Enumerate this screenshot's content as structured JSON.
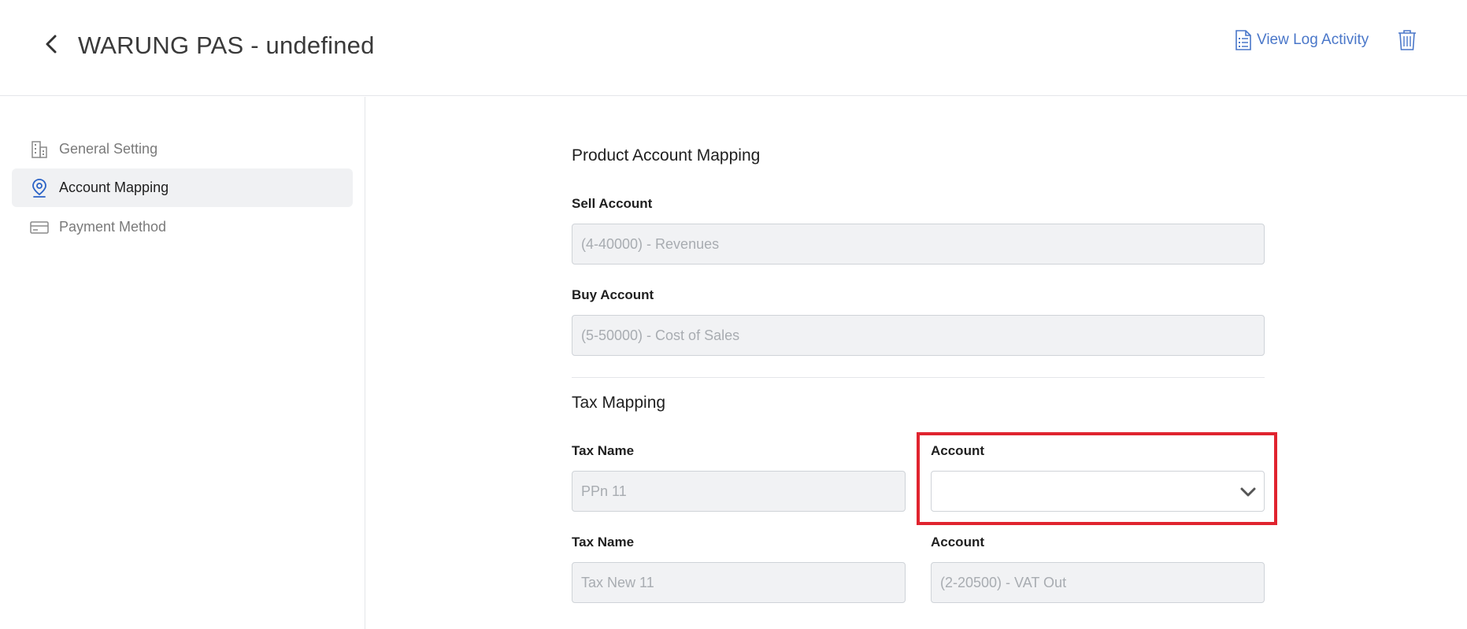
{
  "header": {
    "title": "WARUNG PAS - undefined",
    "log_label": "View Log Activity",
    "icons": {
      "back": "chevron-left-icon",
      "log": "document-list-icon",
      "delete": "trash-icon"
    }
  },
  "sidebar": {
    "items": [
      {
        "label": "General Setting",
        "icon": "building-icon",
        "active": false
      },
      {
        "label": "Account Mapping",
        "icon": "map-pin-icon",
        "active": true
      },
      {
        "label": "Payment Method",
        "icon": "credit-card-icon",
        "active": false
      }
    ]
  },
  "product_mapping": {
    "title": "Product Account Mapping",
    "sell": {
      "label": "Sell Account",
      "value": "(4-40000) - Revenues"
    },
    "buy": {
      "label": "Buy Account",
      "value": "(5-50000) - Cost of Sales"
    }
  },
  "tax_mapping": {
    "title": "Tax Mapping",
    "rows": [
      {
        "tax_label": "Tax Name",
        "tax_value": "PPn 11",
        "account_label": "Account",
        "account_value": ""
      },
      {
        "tax_label": "Tax Name",
        "tax_value": "Tax New 11",
        "account_label": "Account",
        "account_value": "(2-20500) - VAT Out"
      }
    ]
  },
  "colors": {
    "accent": "#4a77c9",
    "highlight": "#e0242f",
    "active_bg": "#f0f1f3"
  }
}
